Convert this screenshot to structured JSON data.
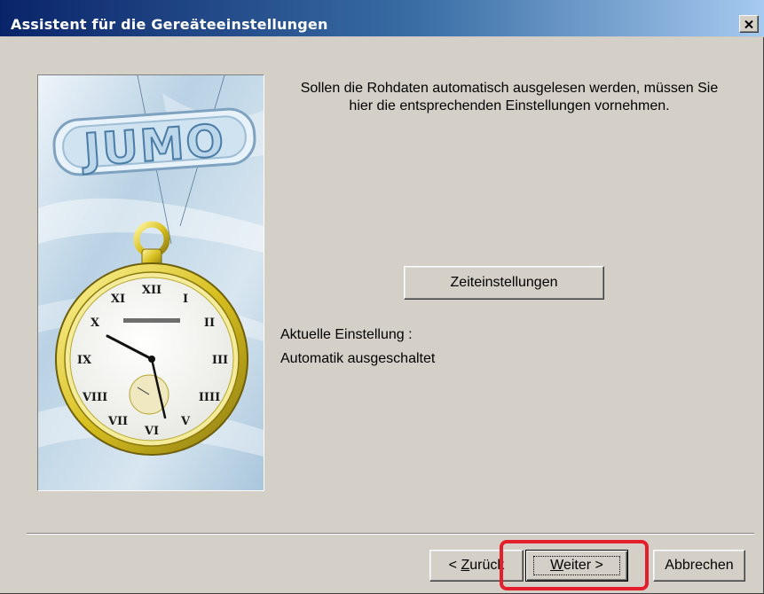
{
  "window": {
    "title": "Assistent für die Gereäteeinstellungen"
  },
  "content": {
    "intro_line1": "Sollen die Rohdaten automatisch ausgelesen werden, müssen Sie",
    "intro_line2": "hier die entsprechenden Einstellungen vornehmen.",
    "time_settings_button": "Zeiteinstellungen",
    "current_setting_label": "Aktuelle Einstellung :",
    "current_setting_value": "Automatik ausgeschaltet"
  },
  "illustration": {
    "logo_text": "JUMO",
    "icon": "pocket-watch-illustration"
  },
  "footer": {
    "back_button": {
      "prefix": "< ",
      "mnemonic": "Z",
      "rest": "urück"
    },
    "next_button": {
      "mnemonic": "W",
      "rest": "eiter >"
    },
    "cancel_button": "Abbrechen"
  },
  "annotation": {
    "highlight_color": "#e41e2b"
  }
}
